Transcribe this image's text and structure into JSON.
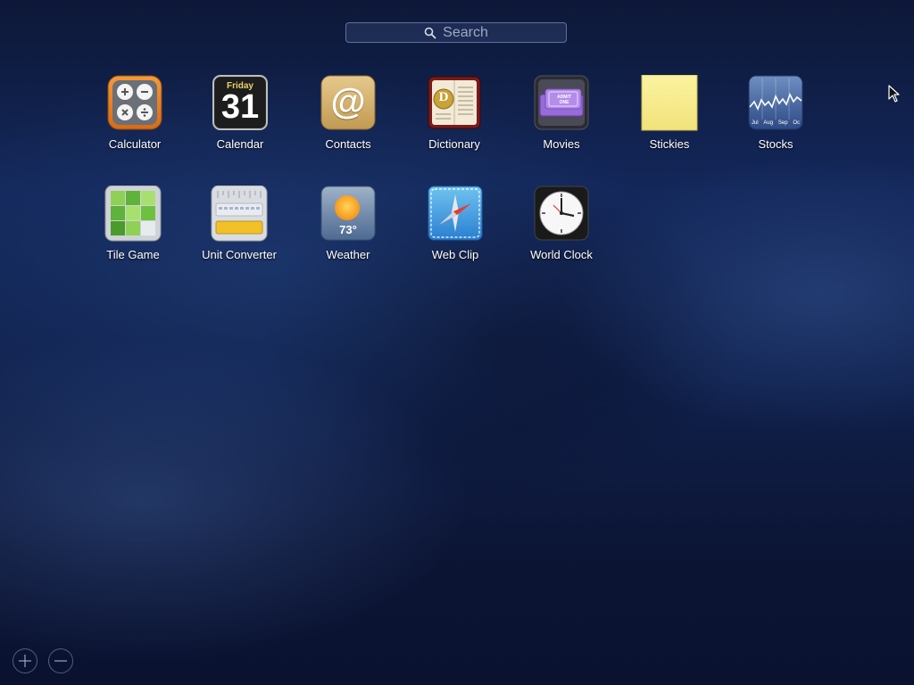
{
  "search": {
    "placeholder": "Search"
  },
  "apps": [
    {
      "label": "Calculator",
      "icon": "calculator-icon"
    },
    {
      "label": "Calendar",
      "icon": "calendar-icon",
      "day_name": "Friday",
      "day_number": "31"
    },
    {
      "label": "Contacts",
      "icon": "contacts-icon",
      "glyph": "@"
    },
    {
      "label": "Dictionary",
      "icon": "dictionary-icon",
      "glyph": "D"
    },
    {
      "label": "Movies",
      "icon": "movies-icon",
      "ticket_text": "ADMIT ONE"
    },
    {
      "label": "Stickies",
      "icon": "stickies-icon"
    },
    {
      "label": "Stocks",
      "icon": "stocks-icon",
      "months": [
        "Jul",
        "Aug",
        "Sep",
        "Oc"
      ]
    },
    {
      "label": "Tile Game",
      "icon": "tile-game-icon"
    },
    {
      "label": "Unit Converter",
      "icon": "unit-converter-icon"
    },
    {
      "label": "Weather",
      "icon": "weather-icon",
      "temperature": "73°"
    },
    {
      "label": "Web Clip",
      "icon": "web-clip-icon"
    },
    {
      "label": "World Clock",
      "icon": "world-clock-icon"
    }
  ],
  "controls": {
    "add": "add-widget-button",
    "remove": "remove-widget-button"
  },
  "colors": {
    "background": "#10214d",
    "label": "#ffffff",
    "stickies_yellow": "#f6ec8a"
  }
}
